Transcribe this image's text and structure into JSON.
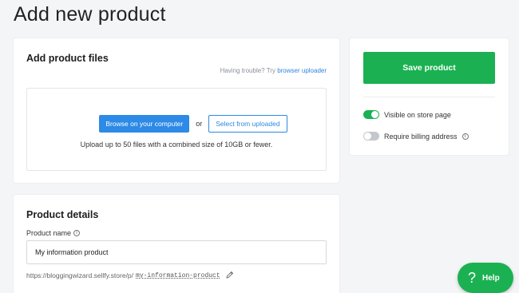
{
  "page": {
    "title": "Add new product"
  },
  "files": {
    "heading": "Add product files",
    "trouble_prefix": "Having trouble? Try",
    "trouble_link": "browser uploader",
    "browse_label": "Browse on your computer",
    "or_text": "or",
    "select_label": "Select from uploaded",
    "hint": "Upload up to 50 files with a combined size of 10GB or fewer."
  },
  "details": {
    "heading": "Product details",
    "name_label": "Product name",
    "name_value": "My information product",
    "url_prefix": "https://bloggingwizard.sellfy.store/p/",
    "url_slug": "my-information-product"
  },
  "sidebar": {
    "save_label": "Save product",
    "visible_label": "Visible on store page",
    "visible_on": true,
    "billing_label": "Require billing address",
    "billing_on": false
  },
  "help": {
    "icon_glyph": "?",
    "label": "Help"
  },
  "icons": {
    "info": "info-icon",
    "pencil": "pencil-icon",
    "help": "question-icon"
  },
  "colors": {
    "accent_green": "#1bb152",
    "accent_blue": "#2d8ae6"
  }
}
